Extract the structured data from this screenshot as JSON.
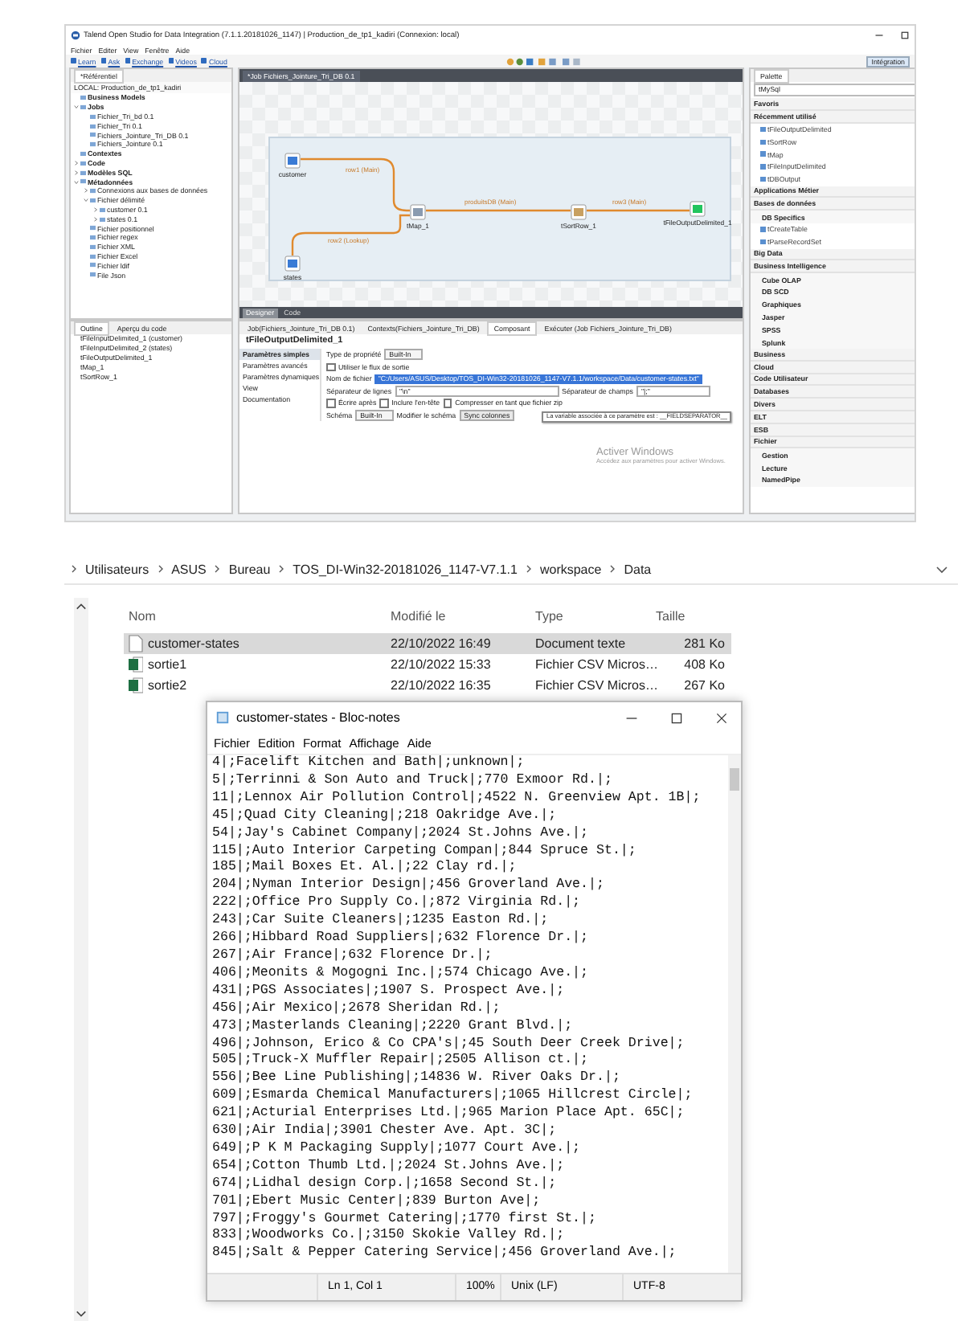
{
  "talend": {
    "title": "Talend Open Studio for Data Integration (7.1.1.20181026_1147) | Production_de_tp1_kadiri (Connexion: local)",
    "menu": [
      "Fichier",
      "Editer",
      "View",
      "Fenêtre",
      "Aide"
    ],
    "links": [
      "Learn",
      "Ask",
      "Exchange",
      "Videos",
      "Cloud"
    ],
    "perspective": "Intégration",
    "repository": {
      "tab": "*Référentiel",
      "root": "LOCAL: Production_de_tp1_kadiri",
      "tree": [
        {
          "label": "Business Models"
        },
        {
          "label": "Jobs",
          "expanded": true,
          "children": [
            {
              "label": "Fichier_Tri_bd 0.1"
            },
            {
              "label": "Fichier_Tri 0.1"
            },
            {
              "label": "Fichiers_Jointure_Tri_DB 0.1"
            },
            {
              "label": "Fichiers_Jointure 0.1"
            }
          ]
        },
        {
          "label": "Contextes"
        },
        {
          "label": "Code",
          "expanded": false
        },
        {
          "label": "Modèles SQL",
          "expanded": false
        },
        {
          "label": "Métadonnées",
          "expanded": true,
          "children": [
            {
              "label": "Connexions aux bases de données",
              "expanded": false
            },
            {
              "label": "Fichier délimité",
              "expanded": true,
              "children": [
                {
                  "label": "customer 0.1",
                  "expanded": false
                },
                {
                  "label": "states 0.1",
                  "expanded": false
                }
              ]
            },
            {
              "label": "Fichier positionnel"
            },
            {
              "label": "Fichier regex"
            },
            {
              "label": "Fichier XML"
            },
            {
              "label": "Fichier Excel"
            },
            {
              "label": "Fichier ldif"
            },
            {
              "label": "File Json"
            }
          ]
        }
      ]
    },
    "job_tab": "*Job Fichiers_Jointure_Tri_DB 0.1",
    "nodes": [
      {
        "label": "customer",
        "kind": "input"
      },
      {
        "label": "tMap_1",
        "kind": "map"
      },
      {
        "label": "tSortRow_1",
        "kind": "sort"
      },
      {
        "label": "tFileOutputDelimited_1",
        "kind": "output"
      },
      {
        "label": "states",
        "kind": "input"
      }
    ],
    "connections": [
      {
        "label": "row1 (Main)"
      },
      {
        "label": "produitsDB (Main)"
      },
      {
        "label": "row3 (Main)"
      },
      {
        "label": "row2 (Lookup)"
      }
    ],
    "designer_tabs": [
      {
        "label": "Designer",
        "selected": true
      },
      {
        "label": "Code",
        "selected": false
      }
    ],
    "palette": {
      "tab": "Palette",
      "search": "tMySql",
      "items": [
        {
          "label": "Favoris",
          "kind": "group"
        },
        {
          "label": "Récemment utilisé",
          "kind": "group"
        },
        {
          "label": "tFileOutputDelimited",
          "kind": "item"
        },
        {
          "label": "tSortRow",
          "kind": "item"
        },
        {
          "label": "tMap",
          "kind": "item"
        },
        {
          "label": "tFileInputDelimited",
          "kind": "item"
        },
        {
          "label": "tDBOutput",
          "kind": "item"
        },
        {
          "label": "Applications Métier",
          "kind": "group"
        },
        {
          "label": "Bases de données",
          "kind": "group"
        },
        {
          "label": "DB Specifics",
          "kind": "subgroup"
        },
        {
          "label": "tCreateTable",
          "kind": "item"
        },
        {
          "label": "tParseRecordSet",
          "kind": "item"
        },
        {
          "label": "Big Data",
          "kind": "group"
        },
        {
          "label": "Business Intelligence",
          "kind": "group"
        },
        {
          "label": "Cube OLAP",
          "kind": "subgroup"
        },
        {
          "label": "DB SCD",
          "kind": "subgroup"
        },
        {
          "label": "Graphiques",
          "kind": "subgroup"
        },
        {
          "label": "Jasper",
          "kind": "subgroup"
        },
        {
          "label": "SPSS",
          "kind": "subgroup"
        },
        {
          "label": "Splunk",
          "kind": "subgroup"
        },
        {
          "label": "Business",
          "kind": "group"
        },
        {
          "label": "Cloud",
          "kind": "group"
        },
        {
          "label": "Code Utilisateur",
          "kind": "group"
        },
        {
          "label": "Databases",
          "kind": "group"
        },
        {
          "label": "Divers",
          "kind": "group"
        },
        {
          "label": "ELT",
          "kind": "group"
        },
        {
          "label": "ESB",
          "kind": "group"
        },
        {
          "label": "Fichier",
          "kind": "group"
        },
        {
          "label": "Gestion",
          "kind": "subgroup"
        },
        {
          "label": "Lecture",
          "kind": "subgroup"
        },
        {
          "label": "NamedPipe",
          "kind": "subgroup"
        }
      ]
    },
    "outline": {
      "tabs": [
        {
          "label": "Outline",
          "selected": true
        },
        {
          "label": "Aperçu du code",
          "selected": false
        }
      ],
      "items": [
        "tFileInputDelimited_1 (customer)",
        "tFileInputDelimited_2 (states)",
        "tFileOutputDelimited_1",
        "tMap_1",
        "tSortRow_1"
      ]
    },
    "component": {
      "tabs": [
        {
          "label": "Job(Fichiers_Jointure_Tri_DB 0.1)",
          "selected": false
        },
        {
          "label": "Contexts(Fichiers_Jointure_Tri_DB)",
          "selected": false
        },
        {
          "label": "Composant",
          "selected": true
        },
        {
          "label": "Exécuter (Job Fichiers_Jointure_Tri_DB)",
          "selected": false
        }
      ],
      "title": "tFileOutputDelimited_1",
      "sections": [
        {
          "label": "Paramètres simples",
          "selected": true
        },
        {
          "label": "Paramètres avancés",
          "selected": false
        },
        {
          "label": "Paramètres dynamiques",
          "selected": false
        },
        {
          "label": "View",
          "selected": false
        },
        {
          "label": "Documentation",
          "selected": false
        }
      ],
      "property_type": {
        "label": "Type de propriété",
        "value": "Built-In"
      },
      "use_output_stream": {
        "label": "Utiliser le flux de sortie",
        "checked": false
      },
      "file_name": {
        "label": "Nom de fichier",
        "value": "\"C:/Users/ASUS/Desktop/TOS_DI-Win32-20181026_1147-V7.1.1/workspace/Data/customer-states.txt\""
      },
      "row_separator": {
        "label": "Séparateur de lignes",
        "value": "\"\\n\""
      },
      "field_separator": {
        "label": "Séparateur de champs",
        "value": "\"|;\""
      },
      "options": [
        {
          "label": "Écrire après",
          "checked": false
        },
        {
          "label": "Inclure l'en-tête",
          "checked": false
        },
        {
          "label": "Compresser en tant que fichier zip",
          "checked": false
        }
      ],
      "schema": {
        "label": "Schéma",
        "value": "Built-In",
        "edit_label": "Modifier le schéma",
        "sync_button": "Sync colonnes"
      },
      "tooltip": "La variable associée à ce paramètre est : __FIELDSEPARATOR__"
    },
    "activation": {
      "title": "Activer Windows",
      "text": "Accédez aux paramètres pour activer Windows."
    }
  },
  "explorer": {
    "breadcrumb": [
      "Utilisateurs",
      "ASUS",
      "Bureau",
      "TOS_DI-Win32-20181026_1147-V7.1.1",
      "workspace",
      "Data"
    ],
    "columns": [
      "Nom",
      "Modifié le",
      "Type",
      "Taille"
    ],
    "files": [
      {
        "name": "customer-states",
        "modified": "22/10/2022 16:49",
        "type": "Document texte",
        "size": "281 Ko",
        "kind": "text",
        "selected": true
      },
      {
        "name": "sortie1",
        "modified": "22/10/2022 15:33",
        "type": "Fichier CSV Micros…",
        "size": "408 Ko",
        "kind": "excel",
        "selected": false
      },
      {
        "name": "sortie2",
        "modified": "22/10/2022 16:35",
        "type": "Fichier CSV Micros…",
        "size": "267 Ko",
        "kind": "excel",
        "selected": false
      }
    ]
  },
  "notepad": {
    "title": "customer-states - Bloc-notes",
    "menu": [
      "Fichier",
      "Edition",
      "Format",
      "Affichage",
      "Aide"
    ],
    "lines": [
      "4|;Facelift Kitchen and Bath|;unknown|;",
      "5|;Terrinni & Son Auto and Truck|;770 Exmoor Rd.|;",
      "11|;Lennox Air Pollution Control|;4522 N. Greenview Apt. 1B|;",
      "45|;Quad City Cleaning|;218 Oakridge Ave.|;",
      "54|;Jay's Cabinet Company|;2024 St.Johns Ave.|;",
      "115|;Auto Interior Carpeting Compan|;844 Spruce St.|;",
      "185|;Mail Boxes Et. Al.|;22 Clay rd.|;",
      "204|;Nyman Interior Design|;456 Groverland Ave.|;",
      "222|;Office Pro Supply Co.|;872 Virginia Rd.|;",
      "243|;Car Suite Cleaners|;1235 Easton Rd.|;",
      "266|;Hibbard Road Suppliers|;632 Florence Dr.|;",
      "267|;Air France|;632 Florence Dr.|;",
      "406|;Meonits & Mogogni Inc.|;574 Chicago Ave.|;",
      "431|;PGS Associates|;1907 S. Prospect Ave.|;",
      "456|;Air Mexico|;2678 Sheridan Rd.|;",
      "473|;Masterlands Cleaning|;2220 Grant Blvd.|;",
      "496|;Johnson, Erico & Co CPA's|;45 South Deer Creek Drive|;",
      "505|;Truck-X Muffler Repair|;2505 Allison ct.|;",
      "556|;Bee Line Publishing|;14836 W. River Oaks Dr.|;",
      "609|;Esmarda Chemical Manufacturers|;1065 Hillcrest Circle|;",
      "621|;Acturial Enterprises Ltd.|;965 Marion Place Apt. 65C|;",
      "630|;Air India|;3901 Chester Ave. Apt. 3C|;",
      "649|;P K M Packaging Supply|;1077 Court Ave.|;",
      "654|;Cotton Thumb Ltd.|;2024 St.Johns Ave.|;",
      "674|;Lidhal design Corp.|;1658 Second St.|;",
      "701|;Ebert Music Center|;839 Burton Ave|;",
      "797|;Froggy's Gourmet Catering|;1770 first St.|;",
      "833|;Woodworks Co.|;3150 Skokie Valley Rd.|;",
      "845|;Salt & Pepper Catering Service|;456 Groverland Ave.|;"
    ],
    "status": [
      "Ln 1, Col 1",
      "100%",
      "Unix (LF)",
      "UTF-8"
    ]
  }
}
